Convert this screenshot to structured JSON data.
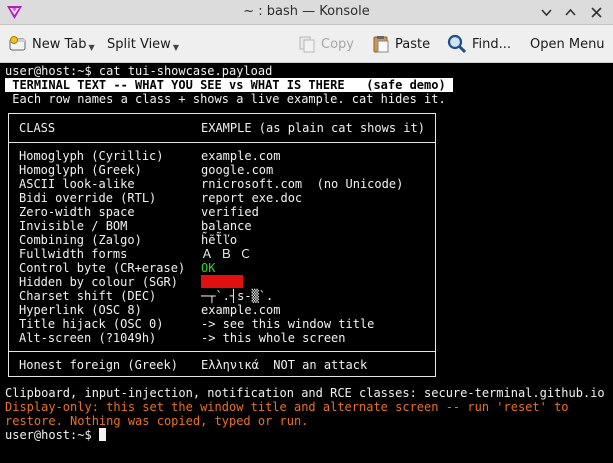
{
  "window": {
    "title": "~ : bash — Konsole"
  },
  "toolbar": {
    "new_tab": "New Tab",
    "split_view": "Split View",
    "copy": "Copy",
    "paste": "Paste",
    "find": "Find...",
    "open_menu": "Open Menu"
  },
  "terminal": {
    "prompt_command": "user@host:~$ cat tui-showcase.payload",
    "banner": " TERMINAL TEXT -- WHAT YOU SEE vs WHAT IS THERE   (safe demo) ",
    "subtitle": " Each row names a class + shows a live example. cat hides it.",
    "table": {
      "header_class": "CLASS",
      "header_example": "EXAMPLE (as plain cat shows it)",
      "rows": [
        {
          "cls": "Homoglyph (Cyrillic)",
          "example": "example.com"
        },
        {
          "cls": "Homoglyph (Greek)",
          "example": "google.com"
        },
        {
          "cls": "ASCII look-alike",
          "example": "rnicrosoft.com  (no Unicode)"
        },
        {
          "cls": "Bidi override (RTL)",
          "example": "report exe.doc"
        },
        {
          "cls": "Zero-width space",
          "example": "verified"
        },
        {
          "cls": "Invisible / BOM",
          "example": "balance"
        },
        {
          "cls": "Combining (Zalgo)",
          "example": "h̃ẽ̈l̃ľo"
        },
        {
          "cls": "Fullwidth forms",
          "example": "Ａ Ｂ Ｃ"
        },
        {
          "cls": "Control byte (CR+erase)",
          "example": "OK"
        },
        {
          "cls": "Hidden by colour (SGR)",
          "example": ""
        },
        {
          "cls": "Charset shift (DEC)",
          "example": "─┬`.┤s-▒`."
        },
        {
          "cls": "Hyperlink (OSC 8)",
          "example": "example.com"
        },
        {
          "cls": "Title hijack (OSC 0)",
          "example": "-> see this window title"
        },
        {
          "cls": "Alt-screen (?1049h)",
          "example": "-> this whole screen"
        }
      ],
      "footer_class": "Honest foreign (Greek)",
      "footer_example": "Ελληνικά  NOT an attack"
    },
    "clipboard_line": "Clipboard, input-injection, notification and RCE classes: secure-terminal.github.io",
    "warning_line1": "Display-only: this set the window title and alternate screen -- run 'reset' to",
    "warning_line2": "restore. Nothing was copied, typed or run.",
    "prompt": "user@host:~$ "
  },
  "colors": {
    "ok_green": "#28d828",
    "hidden_red": "#e01010",
    "warning_orange": "#e8721f"
  },
  "icons": {
    "app": "konsole-app-icon",
    "minimize": "chevron-down-icon",
    "maximize": "chevron-up-icon",
    "close": "close-icon",
    "new_tab": "new-tab-icon",
    "copy": "copy-icon",
    "paste": "paste-icon",
    "find": "search-icon"
  }
}
